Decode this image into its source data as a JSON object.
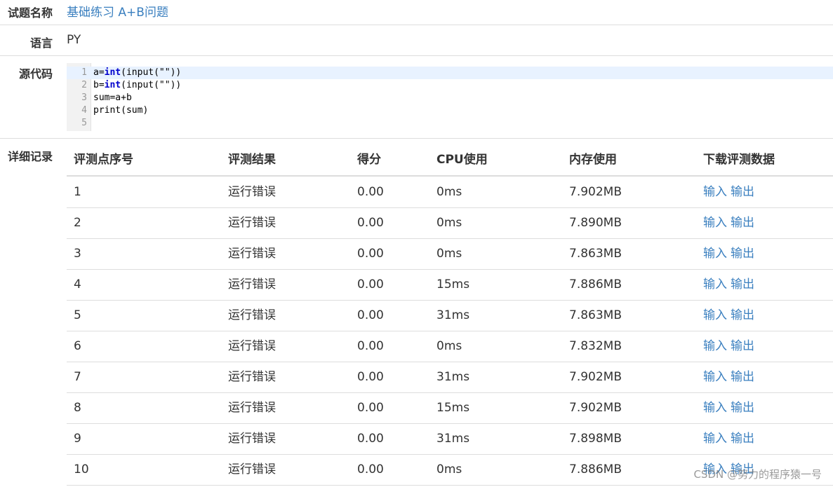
{
  "problem": {
    "label": "试题名称",
    "value": "基础练习 A+B问题"
  },
  "language": {
    "label": "语言",
    "value": "PY"
  },
  "source": {
    "label": "源代码",
    "lines": [
      {
        "no": "1",
        "parts": [
          {
            "t": "a=",
            "kw": false
          },
          {
            "t": "int",
            "kw": true
          },
          {
            "t": "(input(\"\"))",
            "kw": false
          }
        ]
      },
      {
        "no": "2",
        "parts": [
          {
            "t": "b=",
            "kw": false
          },
          {
            "t": "int",
            "kw": true
          },
          {
            "t": "(input(\"\"))",
            "kw": false
          }
        ]
      },
      {
        "no": "3",
        "parts": [
          {
            "t": "sum=a+b",
            "kw": false
          }
        ]
      },
      {
        "no": "4",
        "parts": [
          {
            "t": "print(sum)",
            "kw": false
          }
        ]
      },
      {
        "no": "5",
        "parts": []
      }
    ]
  },
  "details": {
    "label": "详细记录",
    "headers": [
      "评测点序号",
      "评测结果",
      "得分",
      "CPU使用",
      "内存使用",
      "下载评测数据"
    ],
    "input_link": "输入",
    "output_link": "输出",
    "rows": [
      {
        "id": "1",
        "result": "运行错误",
        "score": "0.00",
        "cpu": "0ms",
        "mem": "7.902MB"
      },
      {
        "id": "2",
        "result": "运行错误",
        "score": "0.00",
        "cpu": "0ms",
        "mem": "7.890MB"
      },
      {
        "id": "3",
        "result": "运行错误",
        "score": "0.00",
        "cpu": "0ms",
        "mem": "7.863MB"
      },
      {
        "id": "4",
        "result": "运行错误",
        "score": "0.00",
        "cpu": "15ms",
        "mem": "7.886MB"
      },
      {
        "id": "5",
        "result": "运行错误",
        "score": "0.00",
        "cpu": "31ms",
        "mem": "7.863MB"
      },
      {
        "id": "6",
        "result": "运行错误",
        "score": "0.00",
        "cpu": "0ms",
        "mem": "7.832MB"
      },
      {
        "id": "7",
        "result": "运行错误",
        "score": "0.00",
        "cpu": "31ms",
        "mem": "7.902MB"
      },
      {
        "id": "8",
        "result": "运行错误",
        "score": "0.00",
        "cpu": "15ms",
        "mem": "7.902MB"
      },
      {
        "id": "9",
        "result": "运行错误",
        "score": "0.00",
        "cpu": "31ms",
        "mem": "7.898MB"
      },
      {
        "id": "10",
        "result": "运行错误",
        "score": "0.00",
        "cpu": "0ms",
        "mem": "7.886MB"
      }
    ]
  },
  "watermark": "CSDN @努力的程序猿一号",
  "colors": {
    "link": "#3a7fbf",
    "keyword": "#0000cc",
    "active_line": "#e8f2ff"
  }
}
